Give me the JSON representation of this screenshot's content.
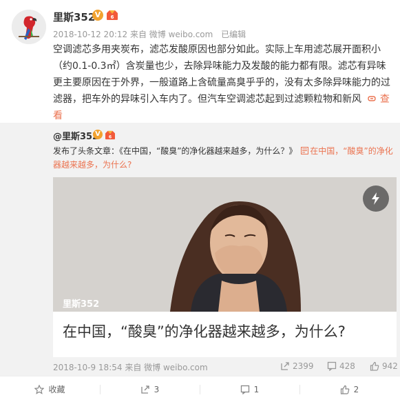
{
  "post": {
    "username": "里斯352",
    "verified_badge": "V",
    "timestamp": "2018-10-12 20:12",
    "source": "来自 微博 weibo.com",
    "edited": "已编辑",
    "text": "空调滤芯多用夹炭布，滤芯发酸原因也部分如此。实际上车用滤芯展开面积小（约0.1-0.3㎡）含炭量也少，去除异味能力及发酸的能力都有限。滤芯有异味更主要原因在于外界，一般道路上含硫量高臭乎乎的，没有太多除异味能力的过滤器，把车外的异味引入车内了。但汽车空调滤芯起到过滤颗粒物和新风",
    "more_label": "查看",
    "link_icon": "link-icon"
  },
  "repost": {
    "username": "@里斯352",
    "verified_badge": "V",
    "text_prefix": "发布了头条文章：《在中国，“酸臭”的净化器越来越多，为什么？》",
    "link_text": "在中国，“酸臭”的净化器越来越多，为什么?",
    "card": {
      "watermark": "里斯352",
      "title": "在中国，“酸臭”的净化器越来越多，为什么?"
    },
    "date": "2018-10-9 18:54",
    "source": "来自 微博 weibo.com",
    "reposts": "2399",
    "comments": "428",
    "likes": "942"
  },
  "actions": {
    "favorite": "收藏",
    "repost_count": "3",
    "comment_count": "1",
    "like_count": "2"
  },
  "colors": {
    "accent": "#eb7350",
    "badge": "#f2a22f"
  }
}
